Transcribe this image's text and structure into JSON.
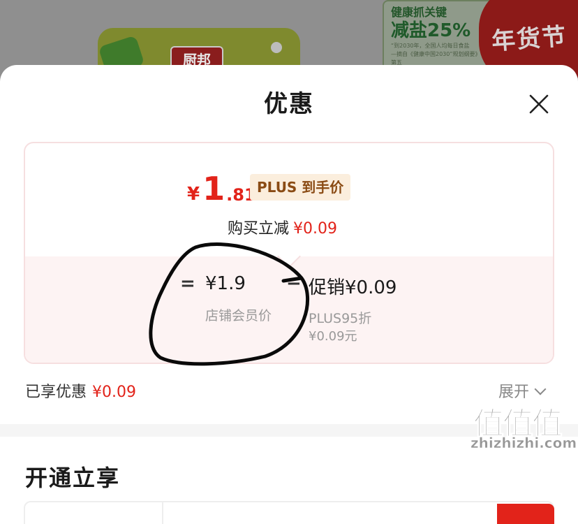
{
  "background": {
    "product_brand": "厨邦",
    "promo_line1": "健康抓关键",
    "promo_line2": "减盐25%",
    "promo_small1": "“到2030年，全国人均每日食盐",
    "promo_small2": "—摘自《健康中国2030”规划纲要》第五",
    "festival": "年货节"
  },
  "sheet": {
    "title": "优惠",
    "close_icon": "close-icon"
  },
  "price_card": {
    "currency": "¥",
    "price_int": "1",
    "price_dec": ".81",
    "plus_badge": "PLUS 到手价",
    "reduce_label": "购买立减",
    "reduce_amount": "¥0.09",
    "components": [
      {
        "operator": "=",
        "value": "¥1.9",
        "label": "店铺会员价"
      },
      {
        "operator": "−",
        "value": "促销¥0.09",
        "label": "PLUS95折",
        "sub": "¥0.09元"
      }
    ],
    "colors": {
      "accent_red": "#e2231a",
      "badge_bg": "#fbeedd",
      "badge_text": "#8a4b14"
    }
  },
  "summary": {
    "saved_label": "已享优惠",
    "saved_amount": "¥0.09",
    "expand_label": "展开",
    "expand_icon": "chevron-down-icon"
  },
  "section": {
    "open_title": "开通立享"
  },
  "watermark": {
    "logo": "值值值",
    "site": "zhizhizhi.com"
  }
}
